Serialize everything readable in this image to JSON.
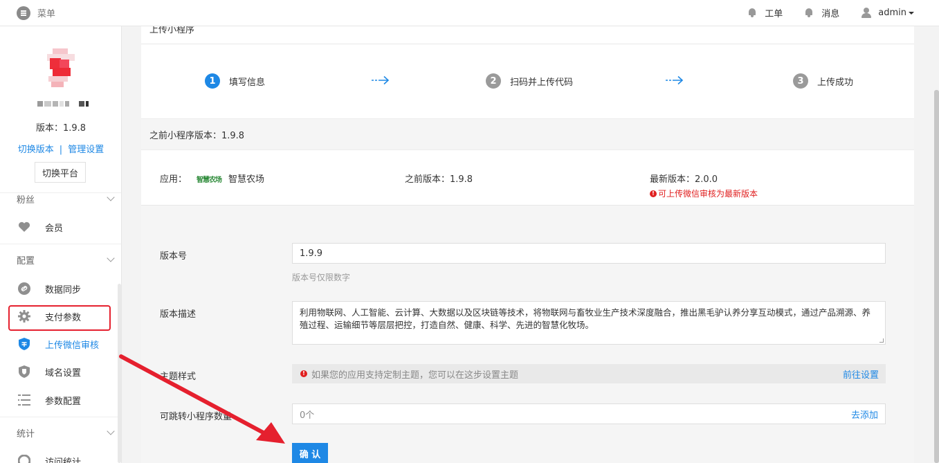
{
  "topbar": {
    "menu_label": "菜单",
    "ticket_label": "工单",
    "message_label": "消息",
    "user_label": "admin"
  },
  "sidebar": {
    "version": "版本：1.9.8",
    "switch_version": "切换版本",
    "link_sep": "|",
    "manage_settings": "管理设置",
    "switch_platform": "切换平台",
    "sections": {
      "fans": "粉丝",
      "config": "配置",
      "stats": "统计"
    },
    "items": [
      {
        "label": "会员",
        "icon": "heart-icon"
      },
      {
        "label": "数据同步",
        "icon": "link-icon"
      },
      {
        "label": "支付参数",
        "icon": "gear-icon"
      },
      {
        "label": "上传微信审核",
        "icon": "shield-icon"
      },
      {
        "label": "域名设置",
        "icon": "shield-icon"
      },
      {
        "label": "参数配置",
        "icon": "list-icon"
      },
      {
        "label": "访问统计",
        "icon": "pie-icon"
      }
    ],
    "active_color": "#1e88e5"
  },
  "main": {
    "title": "上传小程序",
    "steps": [
      {
        "num": "1",
        "label": "填写信息",
        "active": true
      },
      {
        "num": "2",
        "label": "扫码并上传代码",
        "active": false
      },
      {
        "num": "3",
        "label": "上传成功",
        "active": false
      }
    ],
    "prev_version_bar": "之前小程序版本：1.9.8",
    "app": {
      "label": "应用：",
      "logo_text": "智慧农场",
      "name": "智慧农场",
      "prev_version": "之前版本：1.9.8",
      "latest_version": "最新版本：2.0.0",
      "warn": "可上传微信审核为最新版本"
    },
    "form": {
      "version_label": "版本号",
      "version_value": "1.9.9",
      "version_help": "版本号仅限数字",
      "desc_label": "版本描述",
      "desc_value": "利用物联网、人工智能、云计算、大数据以及区块链等技术，将物联网与畜牧业生产技术深度融合，推出黑毛驴认养分享互动模式，通过产品溯源、养殖过程、运输细节等层层把控，打造自然、健康、科学、先进的智慧化牧场。",
      "theme_label": "主题样式",
      "theme_hint": "如果您的应用支持定制主题，您可以在这步设置主题",
      "theme_link": "前往设置",
      "jump_label": "可跳转小程序数量",
      "jump_value": "0个",
      "jump_link": "去添加",
      "confirm": "确 认"
    }
  },
  "colors": {
    "accent": "#1e88e5",
    "warn": "#e02020",
    "annotation": "#e5202e"
  }
}
